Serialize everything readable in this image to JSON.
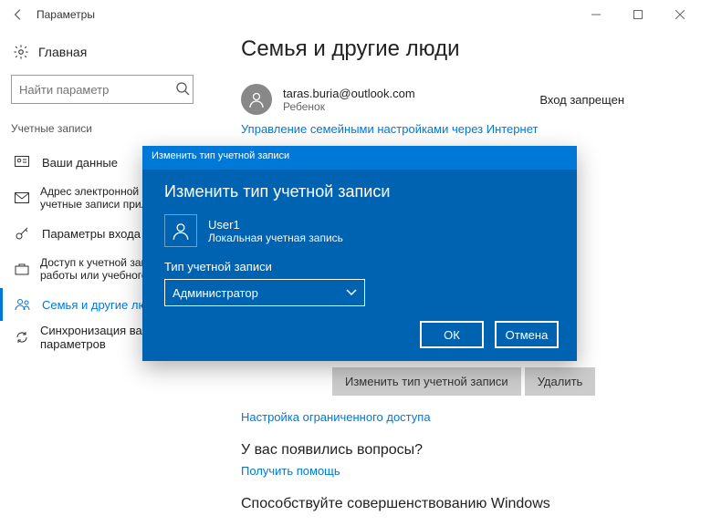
{
  "window": {
    "title": "Параметры"
  },
  "sidebar": {
    "home": "Главная",
    "search_placeholder": "Найти параметр",
    "section": "Учетные записи",
    "items": [
      {
        "label": "Ваши данные"
      },
      {
        "label": "Адрес электронной почты; учетные записи приложений"
      },
      {
        "label": "Параметры входа"
      },
      {
        "label": "Доступ к учетной записи места работы или учебного заведения"
      },
      {
        "label": "Семья и другие люди"
      },
      {
        "label": "Синхронизация ваших параметров"
      }
    ]
  },
  "main": {
    "title": "Семья и другие люди",
    "user_email": "taras.buria@outlook.com",
    "user_sub": "Ребенок",
    "user_status": "Вход запрещен",
    "link_manage_family": "Управление семейными настройками через Интернет",
    "btn_change_type": "Изменить тип учетной записи",
    "btn_remove": "Удалить",
    "link_restricted": "Настройка ограниченного доступа",
    "q_title": "У вас появились вопросы?",
    "link_help": "Получить помощь",
    "improve_title": "Способствуйте совершенствованию Windows"
  },
  "dialog": {
    "header": "Изменить тип учетной записи",
    "title": "Изменить тип учетной записи",
    "user_name": "User1",
    "user_sub": "Локальная учетная запись",
    "select_label": "Тип учетной записи",
    "select_value": "Администратор",
    "ok": "ОК",
    "cancel": "Отмена"
  }
}
